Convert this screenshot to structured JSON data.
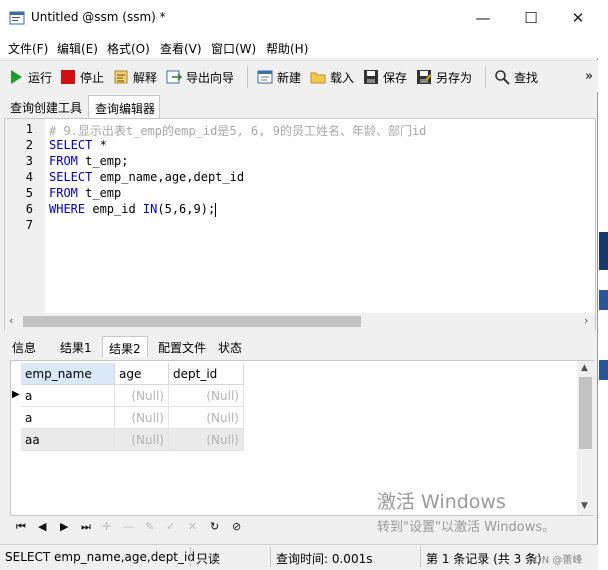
{
  "window": {
    "title": "Untitled @ssm (ssm) *",
    "controls": {
      "minimize": "—",
      "maximize": "☐",
      "close": "✕"
    }
  },
  "menu": [
    "文件(F)",
    "编辑(E)",
    "格式(O)",
    "查看(V)",
    "窗口(W)",
    "帮助(H)"
  ],
  "toolbar": {
    "run": "运行",
    "stop": "停止",
    "explain": "解释",
    "export_wizard": "导出向导",
    "new": "新建",
    "load": "载入",
    "save": "保存",
    "save_as": "另存为",
    "find": "查找",
    "overflow": "»"
  },
  "query_tabs": [
    "查询创建工具",
    "查询编辑器"
  ],
  "editor": {
    "line_numbers": [
      "1",
      "2",
      "3",
      "4",
      "5",
      "6",
      "7"
    ],
    "lines": [
      {
        "parts": [
          {
            "t": "# 9.显示出表t_emp的emp_id是5, 6, 9的员工姓名、年龄、部门id",
            "c": "cm"
          }
        ]
      },
      {
        "parts": [
          {
            "t": "SELECT",
            "c": "kw"
          },
          {
            "t": " *",
            "c": ""
          }
        ]
      },
      {
        "parts": [
          {
            "t": "FROM",
            "c": "kw"
          },
          {
            "t": " t_emp;",
            "c": ""
          }
        ]
      },
      {
        "parts": [
          {
            "t": "SELECT",
            "c": "kw"
          },
          {
            "t": " emp_name,age,dept_id",
            "c": ""
          }
        ]
      },
      {
        "parts": [
          {
            "t": "FROM",
            "c": "kw"
          },
          {
            "t": " t_emp",
            "c": ""
          }
        ]
      },
      {
        "parts": [
          {
            "t": "WHERE",
            "c": "kw"
          },
          {
            "t": " emp_id ",
            "c": ""
          },
          {
            "t": "IN",
            "c": "kw"
          },
          {
            "t": "(5,6,9);",
            "c": ""
          }
        ]
      },
      {
        "parts": [
          {
            "t": "",
            "c": ""
          }
        ]
      }
    ]
  },
  "result_tabs": [
    "信息",
    "结果1",
    "结果2",
    "配置文件",
    "状态"
  ],
  "result_active_tab": 2,
  "grid": {
    "columns": [
      "emp_name",
      "age",
      "dept_id"
    ],
    "rows": [
      [
        "a",
        "(Null)",
        "(Null)"
      ],
      [
        "a",
        "(Null)",
        "(Null)"
      ],
      [
        "aa",
        "(Null)",
        "(Null)"
      ]
    ]
  },
  "status": {
    "query": "SELECT emp_name,age,dept_id",
    "readonly": "只读",
    "query_time": "查询时间: 0.001s",
    "records": "第 1 条记录 (共 3 条)"
  },
  "watermark": {
    "line1": "激活 Windows",
    "line2": "转到\"设置\"以激活 Windows。",
    "corner": "DN @蕾峰"
  },
  "colors": {
    "keyword": "#0000cc",
    "comment": "#a8a8a8",
    "run_icon": "#1c9a2a",
    "stop_icon": "#d01010"
  }
}
